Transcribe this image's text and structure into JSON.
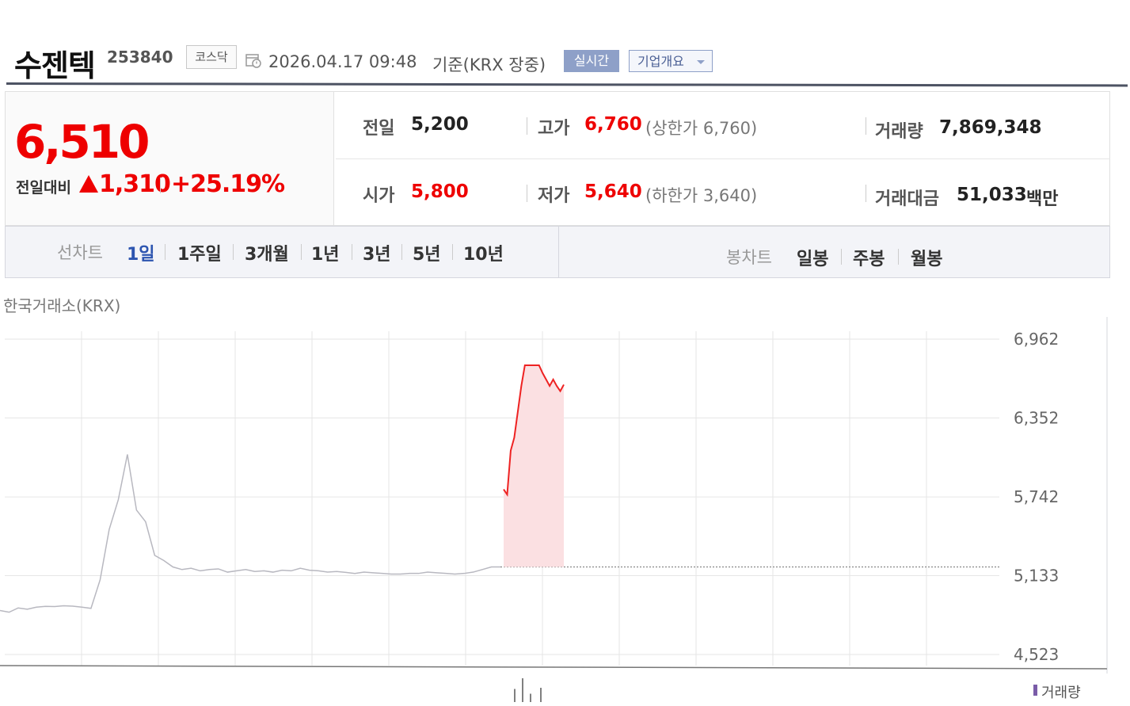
{
  "header": {
    "name": "수젠텍",
    "code": "253840",
    "market": "코스닥",
    "timestamp": "2026.04.17 09:48",
    "basis": "기준(KRX 장중)",
    "realtime_btn": "실시간",
    "company_btn": "기업개요"
  },
  "price": {
    "current": "6,510",
    "diff_label": "전일대비",
    "diff_value": "1,310",
    "diff_rate": "+25.19%",
    "direction": "up"
  },
  "stats": {
    "prev_label": "전일",
    "prev_value": "5,200",
    "high_label": "고가",
    "high_value": "6,760",
    "upper_limit": "(상한가 6,760)",
    "volume_label": "거래량",
    "volume_value": "7,869,348",
    "open_label": "시가",
    "open_value": "5,800",
    "low_label": "저가",
    "low_value": "5,640",
    "lower_limit": "(하한가 3,640)",
    "amount_label": "거래대금",
    "amount_value": "51,033",
    "amount_unit": "백만"
  },
  "tabs": {
    "line_label": "선차트",
    "periods": [
      "1일",
      "1주일",
      "3개월",
      "1년",
      "3년",
      "5년",
      "10년"
    ],
    "active": "1일",
    "candle_label": "봉차트",
    "candles": [
      "일봉",
      "주봉",
      "월봉"
    ]
  },
  "exchange": "한국거래소(KRX)",
  "chart_data": {
    "type": "line",
    "y_ticks": [
      "6,962",
      "6,352",
      "5,742",
      "5,133",
      "4,523"
    ],
    "ylim": [
      4523,
      6962
    ],
    "prev_close_line": 5200,
    "grid": true,
    "volume_label": "거래량",
    "colors": {
      "prev_day": "#b8b8c0",
      "today": "#e22",
      "today_fill": "#fbe0e2",
      "grid": "#e6e6e6"
    },
    "prev_day_series": [
      4863,
      4850,
      4883,
      4873,
      4889,
      4895,
      4894,
      4900,
      4897,
      4889,
      4880,
      5100,
      5490,
      5720,
      6070,
      5640,
      5550,
      5290,
      5250,
      5200,
      5180,
      5190,
      5170,
      5180,
      5185,
      5160,
      5170,
      5180,
      5165,
      5170,
      5160,
      5175,
      5170,
      5190,
      5175,
      5170,
      5160,
      5165,
      5158,
      5150,
      5160,
      5155,
      5150,
      5145,
      5145,
      5150,
      5150,
      5160,
      5155,
      5150,
      5145,
      5150,
      5160,
      5180,
      5200,
      5200
    ],
    "today_series": [
      5800,
      5760,
      6100,
      6200,
      6400,
      6600,
      6760,
      6760,
      6760,
      6760,
      6760,
      6700,
      6650,
      6600,
      6650,
      6600,
      6560,
      6610
    ],
    "volume_bars": [
      0.55,
      1.0,
      0.35,
      0.6
    ]
  }
}
